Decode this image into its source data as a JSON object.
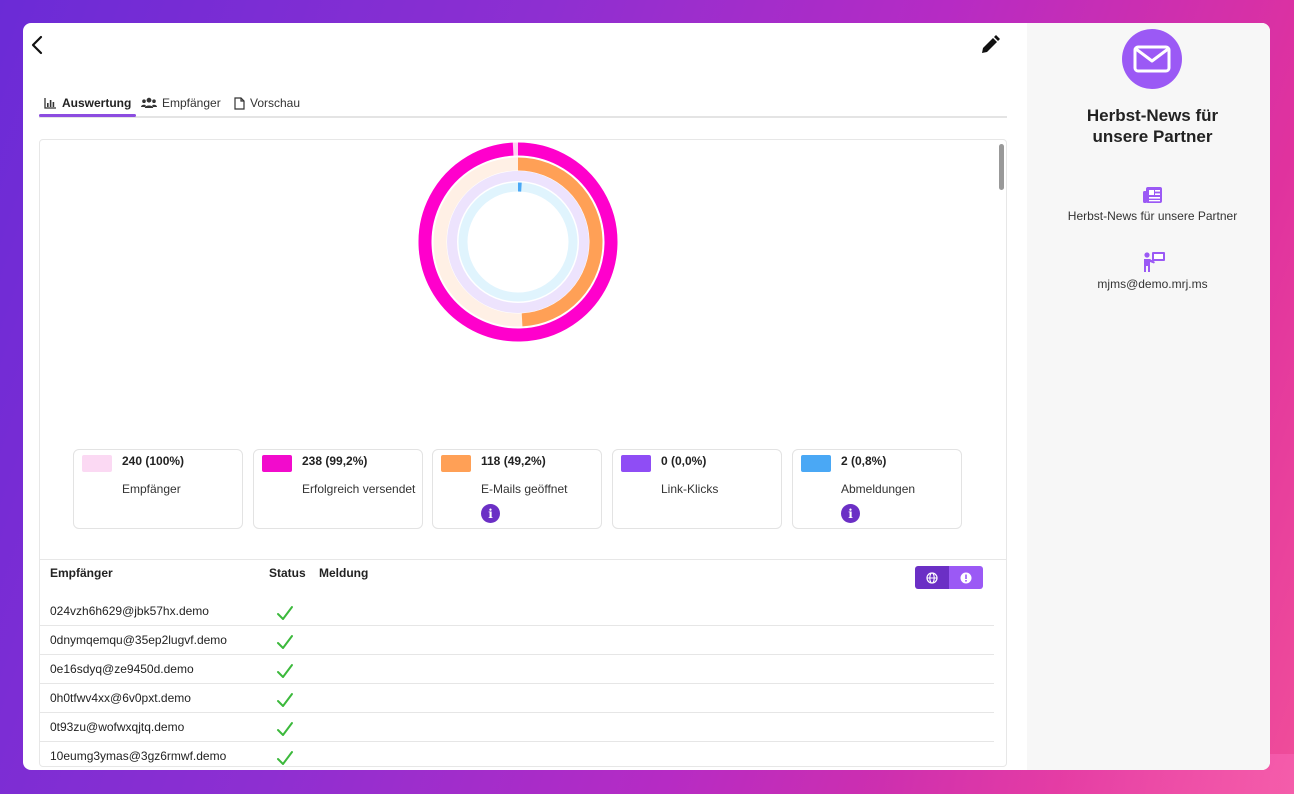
{
  "tabs": [
    {
      "label": "Auswertung",
      "active": true
    },
    {
      "label": "Empfänger",
      "active": false
    },
    {
      "label": "Vorschau",
      "active": false
    }
  ],
  "stats": [
    {
      "value": "240 (100%)",
      "label": "Empfänger",
      "color": "#fbd9f3",
      "info": false
    },
    {
      "value": "238 (99,2%)",
      "label": "Erfolgreich versendet",
      "color": "#f20bcc",
      "info": true
    },
    {
      "value": "118 (49,2%)",
      "label": "E-Mails geöffnet",
      "color": "#ffa056",
      "info": true
    },
    {
      "value": "0 (0,0%)",
      "label": "Link-Klicks",
      "color": "#8f4df5",
      "info": false
    },
    {
      "value": "2 (0,8%)",
      "label": "Abmeldungen",
      "color": "#4aa8f5",
      "info": true
    }
  ],
  "chart_data": {
    "type": "pie",
    "rings": [
      {
        "name": "Erfolgreich versendet",
        "value": 238,
        "total": 240,
        "color": "#ff00cc",
        "track": "#ffd0f3"
      },
      {
        "name": "E-Mails geöffnet",
        "value": 118,
        "total": 240,
        "color": "#ffa056",
        "track": "#fff0e5"
      },
      {
        "name": "Link-Klicks",
        "value": 0,
        "total": 240,
        "color": "#8f4df5",
        "track": "#ede3fd"
      },
      {
        "name": "Abmeldungen",
        "value": 2,
        "total": 240,
        "color": "#4aa8f5",
        "track": "#e0f4fd"
      }
    ]
  },
  "table": {
    "headers": {
      "recipient": "Empfänger",
      "status": "Status",
      "message": "Meldung"
    },
    "rows": [
      {
        "email": "024vzh6h629@jbk57hx.demo",
        "status": "ok"
      },
      {
        "email": "0dnymqemqu@35ep2lugvf.demo",
        "status": "ok"
      },
      {
        "email": "0e16sdyq@ze9450d.demo",
        "status": "ok"
      },
      {
        "email": "0h0tfwv4xx@6v0pxt.demo",
        "status": "ok"
      },
      {
        "email": "0t93zu@wofwxqjtq.demo",
        "status": "ok"
      },
      {
        "email": "10eumg3ymas@3gz6rmwf.demo",
        "status": "ok"
      }
    ],
    "toggle": {
      "left_icon": "globe-icon",
      "right_icon": "alert-icon"
    }
  },
  "sidebar": {
    "icon": "envelope-icon",
    "title_line1": "Herbst-News für",
    "title_line2": "unsere Partner",
    "newsletter_name": "Herbst-News für unsere Partner",
    "sender": "mjms@demo.mrj.ms"
  },
  "colors": {
    "accent": "#8c4ce0",
    "toggle_dark": "#6b2fc5",
    "toggle_light": "#9b59f5",
    "check": "#3cb93c"
  }
}
